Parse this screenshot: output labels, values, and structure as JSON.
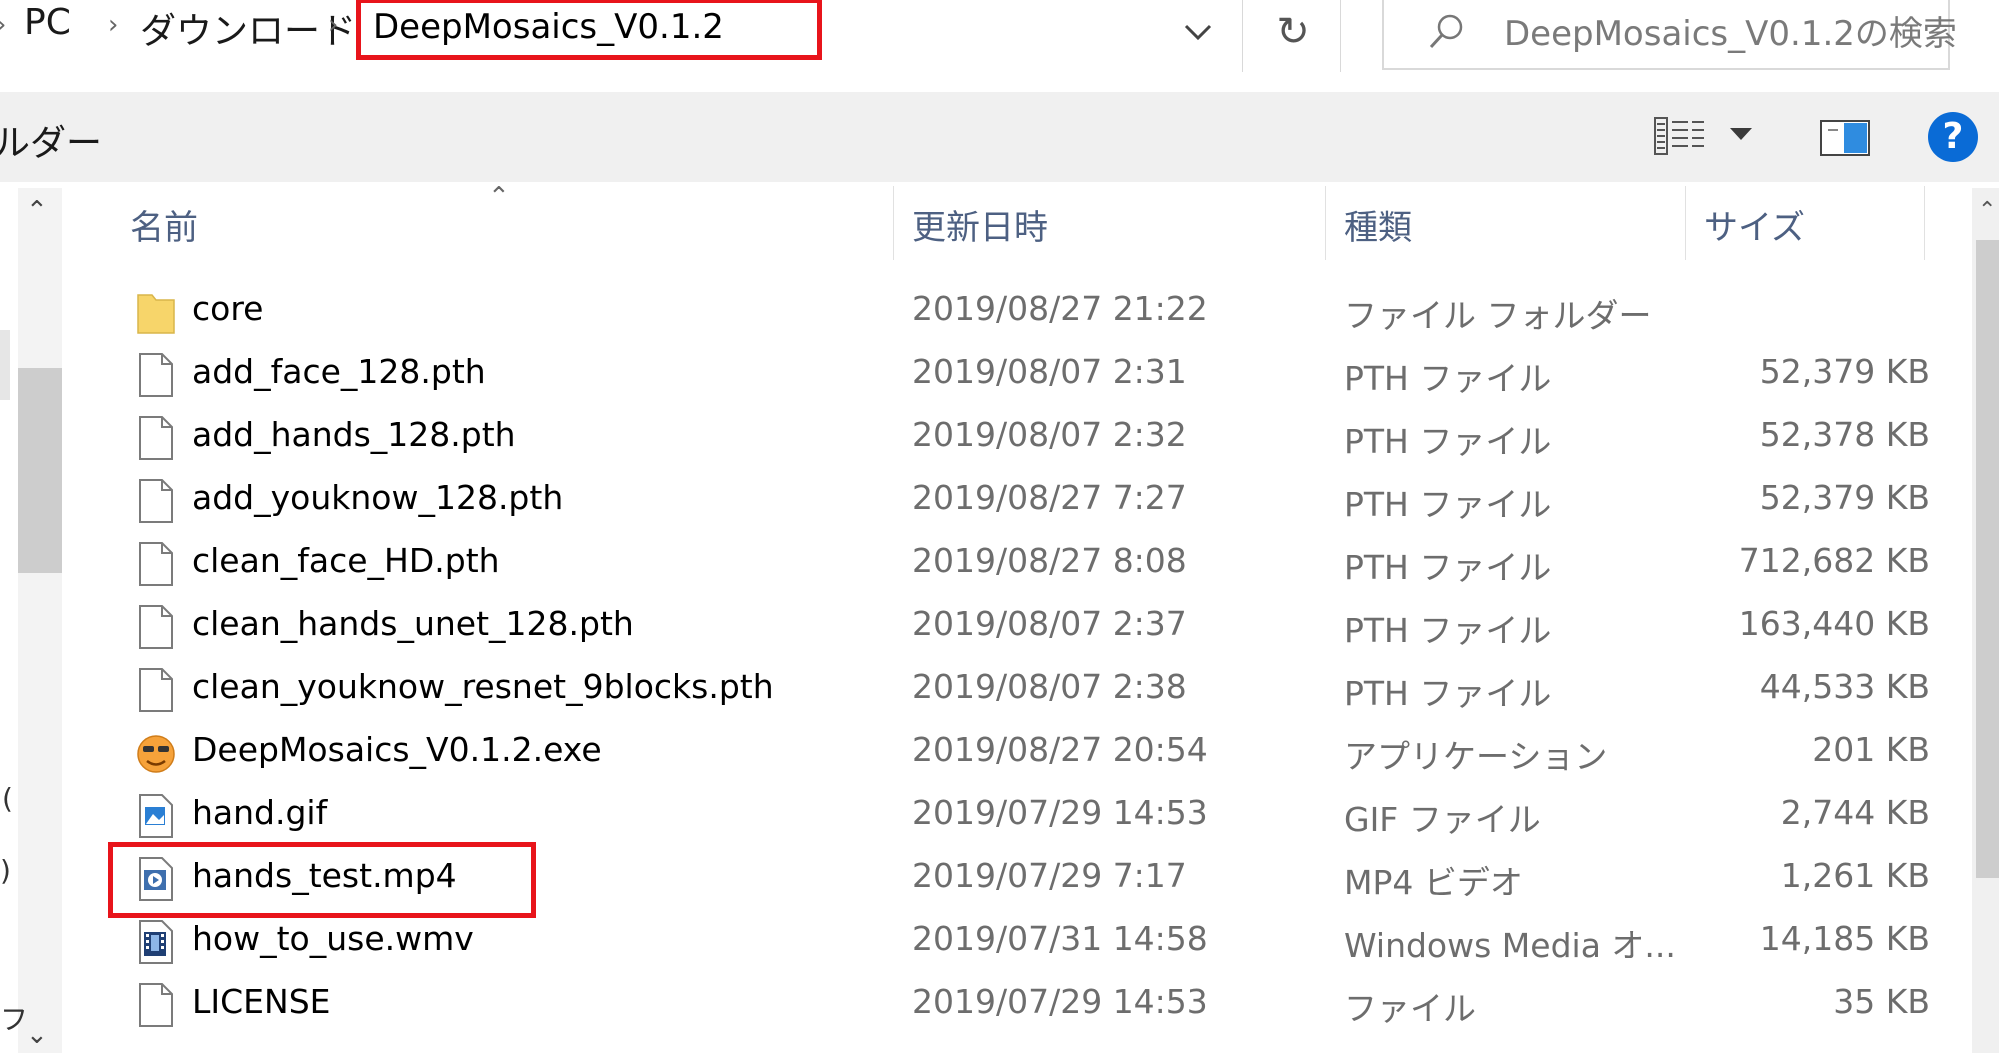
{
  "address_bar": {
    "crumbs": [
      "PC",
      "ダウンロード"
    ],
    "current_folder": "DeepMosaics_V0.1.2",
    "search_placeholder": "DeepMosaics_V0.1.2の検索",
    "refresh_glyph": "↻",
    "icons": [
      "chevron-down-icon",
      "refresh-icon",
      "search-icon"
    ]
  },
  "toolbar": {
    "folder_label": "ルダー",
    "help_glyph": "?",
    "icons": [
      "details-view-icon",
      "view-dropdown-icon",
      "preview-pane-icon",
      "help-icon"
    ]
  },
  "nav_pane": {
    "marks": [
      "(",
      ")",
      "フ"
    ]
  },
  "columns": {
    "name": "名前",
    "date": "更新日時",
    "type": "種類",
    "size": "サイズ"
  },
  "files": [
    {
      "name": "core",
      "date": "2019/08/27 21:22",
      "type": "ファイル フォルダー",
      "size": "",
      "icon": "folder-icon"
    },
    {
      "name": "add_face_128.pth",
      "date": "2019/08/07 2:31",
      "type": "PTH ファイル",
      "size": "52,379 KB",
      "icon": "document-icon"
    },
    {
      "name": "add_hands_128.pth",
      "date": "2019/08/07 2:32",
      "type": "PTH ファイル",
      "size": "52,378 KB",
      "icon": "document-icon"
    },
    {
      "name": "add_youknow_128.pth",
      "date": "2019/08/27 7:27",
      "type": "PTH ファイル",
      "size": "52,379 KB",
      "icon": "document-icon"
    },
    {
      "name": "clean_face_HD.pth",
      "date": "2019/08/27 8:08",
      "type": "PTH ファイル",
      "size": "712,682 KB",
      "icon": "document-icon"
    },
    {
      "name": "clean_hands_unet_128.pth",
      "date": "2019/08/07 2:37",
      "type": "PTH ファイル",
      "size": "163,440 KB",
      "icon": "document-icon"
    },
    {
      "name": "clean_youknow_resnet_9blocks.pth",
      "date": "2019/08/07 2:38",
      "type": "PTH ファイル",
      "size": "44,533 KB",
      "icon": "document-icon"
    },
    {
      "name": "DeepMosaics_V0.1.2.exe",
      "date": "2019/08/27 20:54",
      "type": "アプリケーション",
      "size": "201 KB",
      "icon": "app-emoji-icon"
    },
    {
      "name": "hand.gif",
      "date": "2019/07/29 14:53",
      "type": "GIF ファイル",
      "size": "2,744 KB",
      "icon": "image-file-icon"
    },
    {
      "name": "hands_test.mp4",
      "date": "2019/07/29 7:17",
      "type": "MP4 ビデオ",
      "size": "1,261 KB",
      "icon": "video-file-icon"
    },
    {
      "name": "how_to_use.wmv",
      "date": "2019/07/31 14:58",
      "type": "Windows Media オ...",
      "size": "14,185 KB",
      "icon": "film-file-icon"
    },
    {
      "name": "LICENSE",
      "date": "2019/07/29 14:53",
      "type": "ファイル",
      "size": "35 KB",
      "icon": "document-icon"
    }
  ],
  "colors": {
    "highlight": "#e8141b",
    "header_text": "#4d6082",
    "muted_text": "#6d6d6d",
    "help_blue": "#0a6bd6",
    "folder_yellow": "#f7d56a"
  }
}
